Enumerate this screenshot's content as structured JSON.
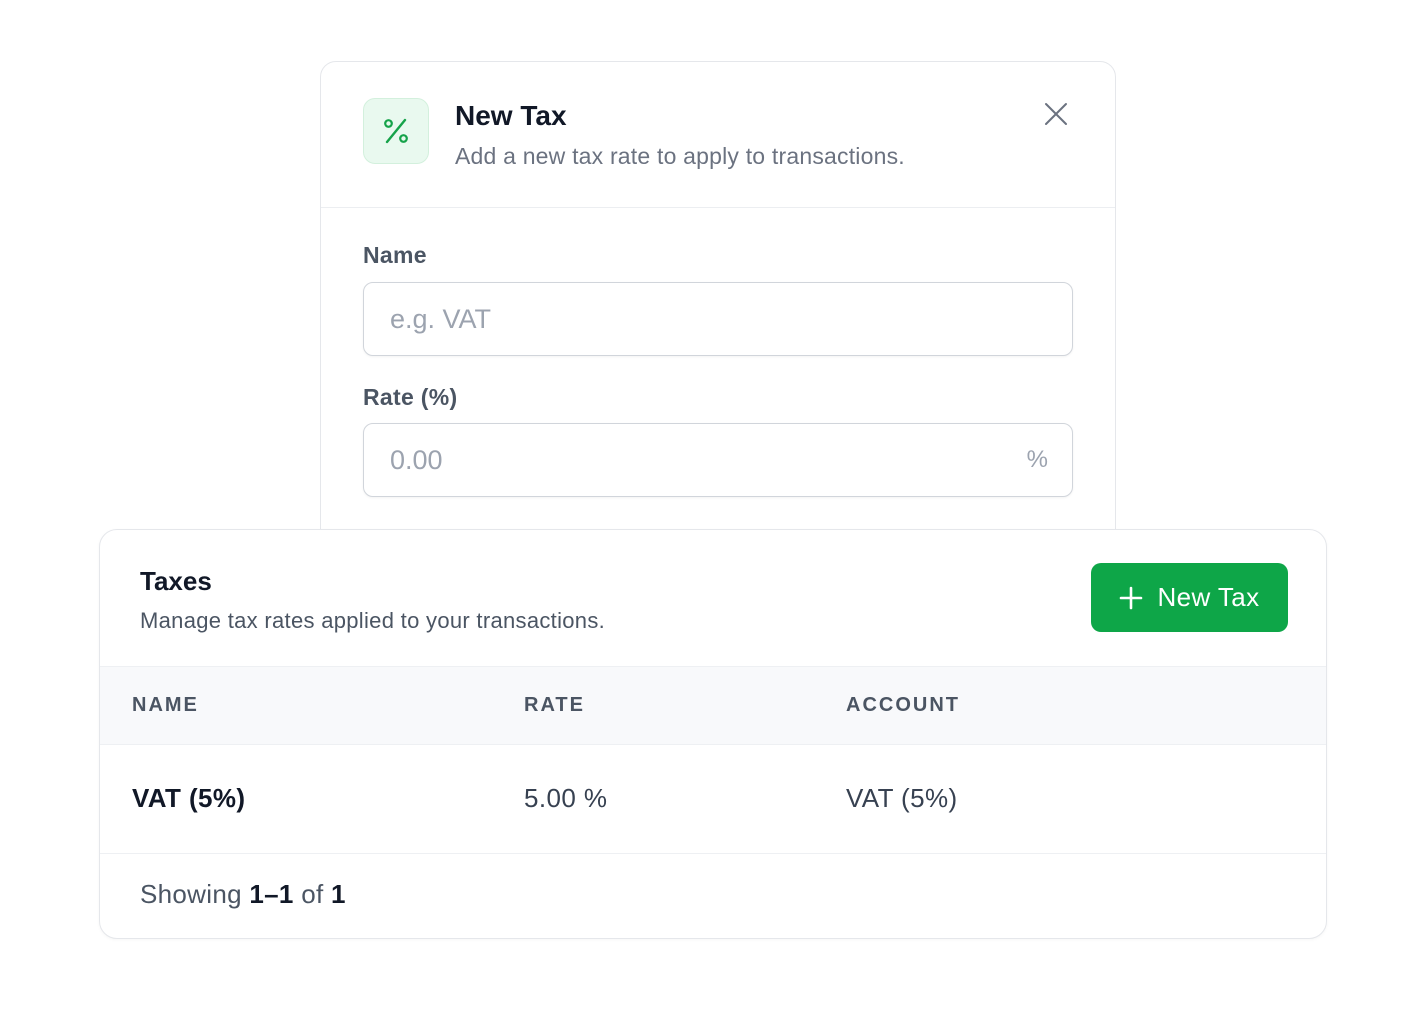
{
  "modal": {
    "title": "New Tax",
    "subtitle": "Add a new tax rate to apply to transactions.",
    "icon": "percent-icon",
    "close_icon": "close-icon",
    "fields": {
      "name": {
        "label": "Name",
        "placeholder": "e.g. VAT",
        "value": ""
      },
      "rate": {
        "label": "Rate (%)",
        "placeholder": "0.00",
        "value": "",
        "suffix": "%"
      }
    }
  },
  "card": {
    "title": "Taxes",
    "subtitle": "Manage tax rates applied to your transactions.",
    "new_button_label": "New Tax",
    "new_button_icon": "plus-icon",
    "columns": [
      "NAME",
      "RATE",
      "ACCOUNT"
    ],
    "rows": [
      {
        "name": "VAT (5%)",
        "rate": "5.00 %",
        "account": "VAT (5%)"
      }
    ],
    "pagination": {
      "prefix": "Showing",
      "range": "1–1",
      "of": "of",
      "total": "1"
    }
  },
  "colors": {
    "accent": "#0ea648",
    "icon_bg": "#e9f9ef",
    "icon_fg": "#16a34a"
  }
}
